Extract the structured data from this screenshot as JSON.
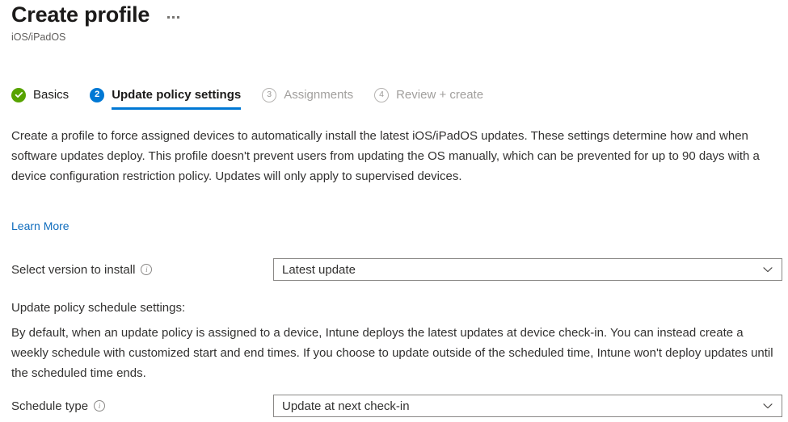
{
  "header": {
    "title": "Create profile",
    "subtitle": "iOS/iPadOS",
    "overflow_menu_label": "..."
  },
  "wizard": {
    "tabs": [
      {
        "number": "1",
        "label": "Basics",
        "state": "completed",
        "badge_glyph": "check"
      },
      {
        "number": "2",
        "label": "Update policy settings",
        "state": "current",
        "badge_glyph": "2"
      },
      {
        "number": "3",
        "label": "Assignments",
        "state": "disabled",
        "badge_glyph": "3"
      },
      {
        "number": "4",
        "label": "Review + create",
        "state": "disabled",
        "badge_glyph": "4"
      }
    ]
  },
  "content": {
    "intro": "Create a profile to force assigned devices to automatically install the latest iOS/iPadOS updates. These settings determine how and when software updates deploy. This profile doesn't prevent users from updating the OS manually, which can be prevented for up to 90 days with a device configuration restriction policy. Updates will only apply to supervised devices.",
    "learn_more": "Learn More",
    "schedule_heading": "Update policy schedule settings:",
    "schedule_description": "By default, when an update policy is assigned to a device, Intune deploys the latest updates at device check-in. You can instead create a weekly schedule with customized start and end times. If you choose to update outside of the scheduled time, Intune won't deploy updates until the scheduled time ends."
  },
  "fields": {
    "version": {
      "label": "Select version to install",
      "value": "Latest update",
      "info_glyph": "i"
    },
    "schedule_type": {
      "label": "Schedule type",
      "value": "Update at next check-in",
      "info_glyph": "i"
    }
  },
  "colors": {
    "accent": "#0078d4",
    "success": "#57a300",
    "link": "#0f6cbd",
    "text": "#323130",
    "disabled_text": "#a19f9d",
    "border": "#8a8886"
  }
}
